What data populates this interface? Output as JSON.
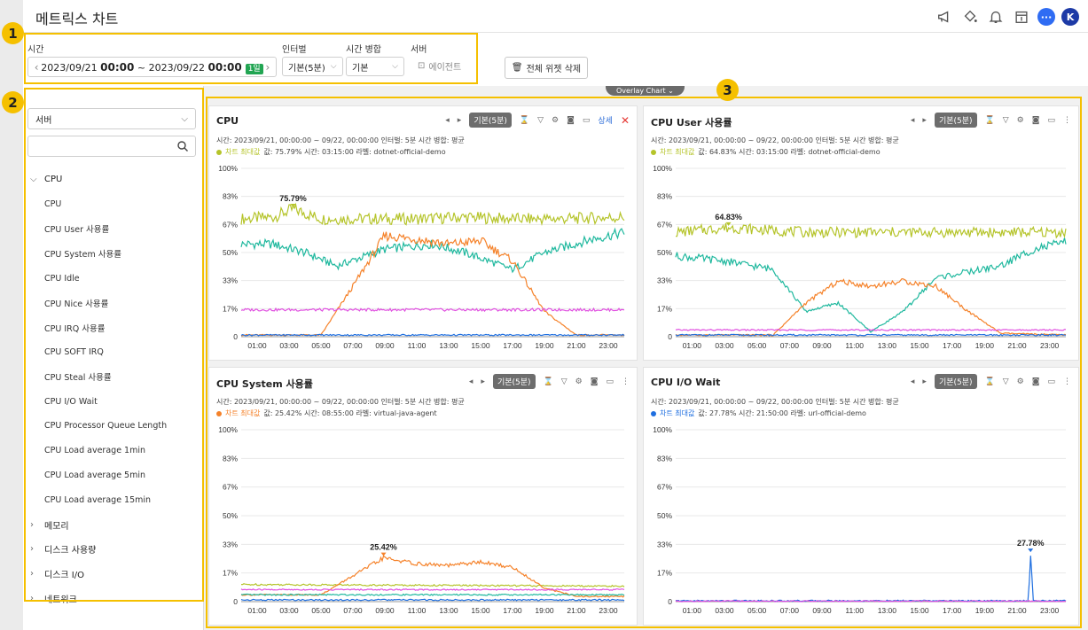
{
  "app": {
    "title": "메트릭스 차트",
    "avatar": "K",
    "chat": "···"
  },
  "header_icons": [
    "megaphone-icon",
    "paint-bucket-icon",
    "bell-icon",
    "calendar-icon",
    "chat-icon",
    "avatar"
  ],
  "badges": [
    "1",
    "2",
    "3"
  ],
  "filters": {
    "time_label": "시간",
    "date_start": "2023/09/21",
    "start_hm": "00:00",
    "range_sep": "~",
    "date_end": "2023/09/22",
    "end_hm": "00:00",
    "duration_tag": "1일",
    "interval_label": "인터벌",
    "interval_value": "기본(5분)",
    "merge_label": "시간 병합",
    "merge_value": "기본",
    "server_label": "서버",
    "agent_text": "에이전트",
    "delete_all": "전체 위젯 삭제"
  },
  "sidebar": {
    "select_value": "서버",
    "search_placeholder": "",
    "groups": [
      {
        "label": "CPU",
        "expanded": true,
        "items": [
          "CPU",
          "CPU User 사용률",
          "CPU System 사용률",
          "CPU Idle",
          "CPU Nice 사용률",
          "CPU IRQ 사용률",
          "CPU SOFT IRQ",
          "CPU Steal 사용률",
          "CPU I/O Wait",
          "CPU Processor Queue Length",
          "CPU Load average 1min",
          "CPU Load average 5min",
          "CPU Load average 15min"
        ]
      },
      {
        "label": "메모리",
        "expanded": false
      },
      {
        "label": "디스크 사용량",
        "expanded": false
      },
      {
        "label": "디스크 I/O",
        "expanded": false
      },
      {
        "label": "네트워크",
        "expanded": false
      }
    ]
  },
  "overlay_tab": "Overlay Chart ⌄",
  "colors": {
    "accent": "#f5c000",
    "olive": "#b5c42a",
    "orange": "#f5822a",
    "teal": "#1fb89e",
    "magenta": "#e050e0",
    "blue": "#1f6fe0",
    "purple": "#7b3fd0"
  },
  "panels": [
    {
      "title": "CPU",
      "interval_btn": "기본(5분)",
      "detail": "상세",
      "closable": true,
      "meta": "시간: 2023/09/21, 00:00:00 ~ 09/22, 00:00:00   인터벌: 5분   시간 병합: 평균",
      "max_label": "차트 최대값",
      "max_info": "값: 75.79%   시간: 03:15:00   라벨: dotnet-official-demo",
      "max_color": "#b5c42a",
      "peak_label": "75.79%",
      "peak_hour": 3.25
    },
    {
      "title": "CPU User 사용률",
      "interval_btn": "기본(5분)",
      "closable": false,
      "meta": "시간: 2023/09/21, 00:00:00 ~ 09/22, 00:00:00   인터벌: 5분   시간 병합: 평균",
      "max_label": "차트 최대값",
      "max_info": "값: 64.83%   시간: 03:15:00   라벨: dotnet-official-demo",
      "max_color": "#b5c42a",
      "peak_label": "64.83%",
      "peak_hour": 3.25
    },
    {
      "title": "CPU System 사용률",
      "interval_btn": "기본(5분)",
      "closable": false,
      "meta": "시간: 2023/09/21, 00:00:00 ~ 09/22, 00:00:00   인터벌: 5분   시간 병합: 평균",
      "max_label": "차트 최대값",
      "max_info": "값: 25.42%   시간: 08:55:00   라벨: virtual-java-agent",
      "max_color": "#f5822a",
      "peak_label": "25.42%",
      "peak_hour": 8.92
    },
    {
      "title": "CPU I/O Wait",
      "interval_btn": "기본(5분)",
      "closable": false,
      "meta": "시간: 2023/09/21, 00:00:00 ~ 09/22, 00:00:00   인터벌: 5분   시간 병합: 평균",
      "max_label": "차트 최대값",
      "max_info": "값: 27.78%   시간: 21:50:00   라벨: url-official-demo",
      "max_color": "#1f6fe0",
      "peak_label": "27.78%",
      "peak_hour": 21.83
    }
  ],
  "chart_data": [
    {
      "type": "line",
      "title": "CPU",
      "y_ticks": [
        "0",
        "17%",
        "33%",
        "50%",
        "67%",
        "83%",
        "100%"
      ],
      "x_ticks": [
        "01:00",
        "03:00",
        "05:00",
        "07:00",
        "09:00",
        "11:00",
        "13:00",
        "15:00",
        "17:00",
        "19:00",
        "21:00",
        "23:00"
      ],
      "ylim": [
        0,
        100
      ],
      "xlim": [
        0,
        24
      ],
      "series": [
        {
          "color": "#b5c42a",
          "values": [
            [
              0,
              70
            ],
            [
              2,
              71
            ],
            [
              3.25,
              75.79
            ],
            [
              5,
              70
            ],
            [
              8,
              70
            ],
            [
              11,
              70
            ],
            [
              14,
              71
            ],
            [
              17,
              70
            ],
            [
              20,
              70
            ],
            [
              24,
              71
            ]
          ]
        },
        {
          "color": "#1fb89e",
          "values": [
            [
              0,
              55
            ],
            [
              2,
              55
            ],
            [
              4,
              50
            ],
            [
              6,
              42
            ],
            [
              9,
              52
            ],
            [
              12,
              55
            ],
            [
              14,
              50
            ],
            [
              17,
              40
            ],
            [
              19,
              50
            ],
            [
              22,
              58
            ],
            [
              24,
              62
            ]
          ]
        },
        {
          "color": "#f5822a",
          "values": [
            [
              0,
              1
            ],
            [
              5,
              1
            ],
            [
              7,
              30
            ],
            [
              9,
              60
            ],
            [
              11,
              58
            ],
            [
              13,
              55
            ],
            [
              15,
              57
            ],
            [
              17,
              45
            ],
            [
              19,
              15
            ],
            [
              21,
              1
            ],
            [
              24,
              1
            ]
          ]
        },
        {
          "color": "#e050e0",
          "values": [
            [
              0,
              16
            ],
            [
              24,
              16
            ]
          ]
        },
        {
          "color": "#1f6fe0",
          "values": [
            [
              0,
              1
            ],
            [
              24,
              1
            ]
          ]
        }
      ]
    },
    {
      "type": "line",
      "title": "CPU User 사용률",
      "y_ticks": [
        "0",
        "17%",
        "33%",
        "50%",
        "67%",
        "83%",
        "100%"
      ],
      "x_ticks": [
        "01:00",
        "03:00",
        "05:00",
        "07:00",
        "09:00",
        "11:00",
        "13:00",
        "15:00",
        "17:00",
        "19:00",
        "21:00",
        "23:00"
      ],
      "ylim": [
        0,
        100
      ],
      "xlim": [
        0,
        24
      ],
      "series": [
        {
          "color": "#b5c42a",
          "values": [
            [
              0,
              62
            ],
            [
              3.25,
              64.83
            ],
            [
              8,
              62
            ],
            [
              16,
              62
            ],
            [
              24,
              62
            ]
          ]
        },
        {
          "color": "#1fb89e",
          "values": [
            [
              0,
              48
            ],
            [
              3,
              45
            ],
            [
              6,
              40
            ],
            [
              8,
              15
            ],
            [
              10,
              20
            ],
            [
              12,
              3
            ],
            [
              14,
              15
            ],
            [
              16,
              35
            ],
            [
              20,
              42
            ],
            [
              22,
              52
            ],
            [
              24,
              56
            ]
          ]
        },
        {
          "color": "#f5822a",
          "values": [
            [
              0,
              1
            ],
            [
              6,
              1
            ],
            [
              8,
              20
            ],
            [
              10,
              33
            ],
            [
              12,
              30
            ],
            [
              14,
              33
            ],
            [
              16,
              30
            ],
            [
              18,
              15
            ],
            [
              20,
              2
            ],
            [
              24,
              1
            ]
          ]
        },
        {
          "color": "#e050e0",
          "values": [
            [
              0,
              4
            ],
            [
              24,
              4
            ]
          ]
        },
        {
          "color": "#1f6fe0",
          "values": [
            [
              0,
              1
            ],
            [
              24,
              1
            ]
          ]
        }
      ]
    },
    {
      "type": "line",
      "title": "CPU System 사용률",
      "y_ticks": [
        "0",
        "17%",
        "33%",
        "50%",
        "67%",
        "83%",
        "100%"
      ],
      "x_ticks": [
        "01:00",
        "03:00",
        "05:00",
        "07:00",
        "09:00",
        "11:00",
        "13:00",
        "15:00",
        "17:00",
        "19:00",
        "21:00",
        "23:00"
      ],
      "ylim": [
        0,
        100
      ],
      "xlim": [
        0,
        24
      ],
      "series": [
        {
          "color": "#b5c42a",
          "values": [
            [
              0,
              10
            ],
            [
              24,
              9
            ]
          ]
        },
        {
          "color": "#f5822a",
          "values": [
            [
              0,
              4
            ],
            [
              5,
              4
            ],
            [
              7,
              15
            ],
            [
              8.92,
              25.42
            ],
            [
              11,
              22
            ],
            [
              13,
              21
            ],
            [
              15,
              23
            ],
            [
              17,
              20
            ],
            [
              19,
              8
            ],
            [
              21,
              3
            ],
            [
              24,
              3
            ]
          ]
        },
        {
          "color": "#e050e0",
          "values": [
            [
              0,
              7
            ],
            [
              24,
              7
            ]
          ]
        },
        {
          "color": "#1fb89e",
          "values": [
            [
              0,
              4
            ],
            [
              24,
              4
            ]
          ]
        },
        {
          "color": "#1f6fe0",
          "values": [
            [
              0,
              1
            ],
            [
              24,
              1
            ]
          ]
        }
      ]
    },
    {
      "type": "line",
      "title": "CPU I/O Wait",
      "y_ticks": [
        "0",
        "17%",
        "33%",
        "50%",
        "67%",
        "83%",
        "100%"
      ],
      "x_ticks": [
        "01:00",
        "03:00",
        "05:00",
        "07:00",
        "09:00",
        "11:00",
        "13:00",
        "15:00",
        "17:00",
        "19:00",
        "21:00",
        "23:00"
      ],
      "ylim": [
        0,
        100
      ],
      "xlim": [
        0,
        24
      ],
      "series": [
        {
          "color": "#1f6fe0",
          "values": [
            [
              0,
              0.5
            ],
            [
              21.7,
              0.5
            ],
            [
              21.83,
              27.78
            ],
            [
              22,
              0.5
            ],
            [
              24,
              0.5
            ]
          ]
        },
        {
          "color": "#e050e0",
          "values": [
            [
              0,
              0.3
            ],
            [
              24,
              0.3
            ]
          ]
        }
      ]
    }
  ]
}
